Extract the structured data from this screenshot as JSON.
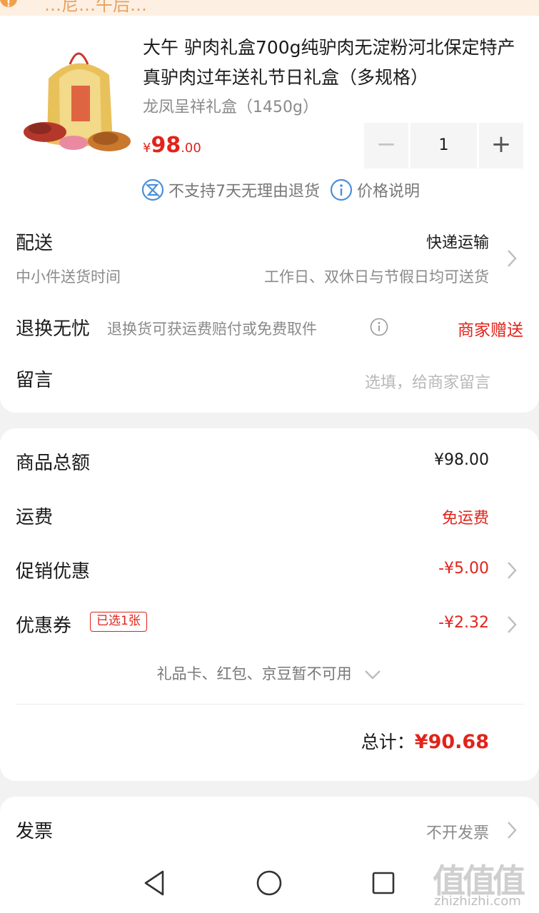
{
  "banner": {
    "text": "…尼…午后…"
  },
  "product": {
    "title": "大午 驴肉礼盒700g纯驴肉无淀粉河北保定特产真驴肉过年送礼节日礼盒（多规格）",
    "spec": "龙凤呈祥礼盒（1450g）",
    "price_symbol": "¥",
    "price_int": "98",
    "price_dec": ".00",
    "quantity": "1",
    "minus": "−",
    "plus": "+",
    "no_return": "不支持7天无理由退货",
    "price_note": "价格说明"
  },
  "delivery": {
    "label": "配送",
    "method": "快递运输",
    "sub_label": "中小件送货时间",
    "time": "工作日、双休日与节假日均可送货"
  },
  "return": {
    "label": "退换无忧",
    "desc": "退换货可获运费赔付或免费取件",
    "gift": "商家赠送"
  },
  "message": {
    "label": "留言",
    "placeholder": "选填，给商家留言"
  },
  "summary": {
    "goods_total_label": "商品总额",
    "goods_total": "¥98.00",
    "shipping_label": "运费",
    "shipping": "免运费",
    "promo_label": "促销优惠",
    "promo": "-¥5.00",
    "coupon_label": "优惠券",
    "coupon_tag": "已选1张",
    "coupon": "-¥2.32",
    "unavailable": "礼品卡、红包、京豆暂不可用",
    "total_label": "总计：",
    "total": "¥90.68"
  },
  "invoice": {
    "label": "发票",
    "value": "不开发票"
  },
  "watermark": {
    "logo": "值值值",
    "url": "zhizhizhi.com"
  },
  "colors": {
    "accent": "#e2231a",
    "icon_blue": "#4a90d9"
  }
}
